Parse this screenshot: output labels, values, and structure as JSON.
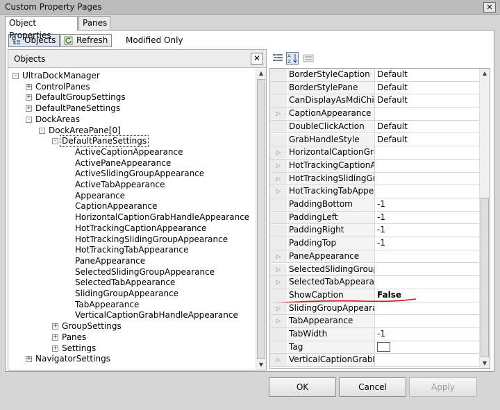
{
  "window": {
    "title": "Custom Property Pages"
  },
  "tabs": [
    {
      "label": "Object Properties"
    },
    {
      "label": "Panes"
    }
  ],
  "toolbar": {
    "objects_label": "Objects",
    "refresh_label": "Refresh",
    "modified_only_label": "Modified Only"
  },
  "objects_panel": {
    "header": "Objects",
    "close_glyph": "✕"
  },
  "tree": [
    {
      "text": "UltraDockManager",
      "level": 0,
      "exp": "-"
    },
    {
      "text": "ControlPanes",
      "level": 1,
      "exp": "+"
    },
    {
      "text": "DefaultGroupSettings",
      "level": 1,
      "exp": "+"
    },
    {
      "text": "DefaultPaneSettings",
      "level": 1,
      "exp": "+"
    },
    {
      "text": "DockAreas",
      "level": 1,
      "exp": "-"
    },
    {
      "text": "DockAreaPane[0]",
      "level": 2,
      "exp": "-"
    },
    {
      "text": "DefaultPaneSettings",
      "level": 3,
      "exp": "-",
      "selected": true
    },
    {
      "text": "ActiveCaptionAppearance",
      "level": 4
    },
    {
      "text": "ActivePaneAppearance",
      "level": 4
    },
    {
      "text": "ActiveSlidingGroupAppearance",
      "level": 4
    },
    {
      "text": "ActiveTabAppearance",
      "level": 4
    },
    {
      "text": "Appearance",
      "level": 4
    },
    {
      "text": "CaptionAppearance",
      "level": 4
    },
    {
      "text": "HorizontalCaptionGrabHandleAppearance",
      "level": 4
    },
    {
      "text": "HotTrackingCaptionAppearance",
      "level": 4
    },
    {
      "text": "HotTrackingSlidingGroupAppearance",
      "level": 4
    },
    {
      "text": "HotTrackingTabAppearance",
      "level": 4
    },
    {
      "text": "PaneAppearance",
      "level": 4
    },
    {
      "text": "SelectedSlidingGroupAppearance",
      "level": 4
    },
    {
      "text": "SelectedTabAppearance",
      "level": 4
    },
    {
      "text": "SlidingGroupAppearance",
      "level": 4
    },
    {
      "text": "TabAppearance",
      "level": 4
    },
    {
      "text": "VerticalCaptionGrabHandleAppearance",
      "level": 4
    },
    {
      "text": "GroupSettings",
      "level": 3,
      "exp": "+"
    },
    {
      "text": "Panes",
      "level": 3,
      "exp": "+"
    },
    {
      "text": "Settings",
      "level": 3,
      "exp": "+"
    },
    {
      "text": "NavigatorSettings",
      "level": 1,
      "exp": "+"
    }
  ],
  "properties": [
    {
      "name": "BorderStyleCaption",
      "value": "Default"
    },
    {
      "name": "BorderStylePane",
      "value": "Default"
    },
    {
      "name": "CanDisplayAsMdiChild",
      "value": "Default"
    },
    {
      "name": "CaptionAppearance",
      "value": "",
      "expandable": true
    },
    {
      "name": "DoubleClickAction",
      "value": "Default"
    },
    {
      "name": "GrabHandleStyle",
      "value": "Default"
    },
    {
      "name": "HorizontalCaptionGrab",
      "value": "",
      "expandable": true
    },
    {
      "name": "HotTrackingCaptionApp",
      "value": "",
      "expandable": true
    },
    {
      "name": "HotTrackingSlidingGrou",
      "value": "",
      "expandable": true
    },
    {
      "name": "HotTrackingTabAppeara",
      "value": "",
      "expandable": true
    },
    {
      "name": "PaddingBottom",
      "value": "-1"
    },
    {
      "name": "PaddingLeft",
      "value": "-1"
    },
    {
      "name": "PaddingRight",
      "value": "-1"
    },
    {
      "name": "PaddingTop",
      "value": "-1"
    },
    {
      "name": "PaneAppearance",
      "value": "",
      "expandable": true
    },
    {
      "name": "SelectedSlidingGroupAp",
      "value": "",
      "expandable": true
    },
    {
      "name": "SelectedTabAppearance",
      "value": "",
      "expandable": true
    },
    {
      "name": "ShowCaption",
      "value": "False",
      "bold": true,
      "annotated": true
    },
    {
      "name": "SlidingGroupAppearanc",
      "value": "",
      "expandable": true
    },
    {
      "name": "TabAppearance",
      "value": "",
      "expandable": true
    },
    {
      "name": "TabWidth",
      "value": "-1"
    },
    {
      "name": "Tag",
      "value": "",
      "colorbox": true
    },
    {
      "name": "VerticalCaptionGrabHar",
      "value": "",
      "expandable": true
    }
  ],
  "buttons": {
    "ok": "OK",
    "cancel": "Cancel",
    "apply": "Apply"
  },
  "colors": {
    "annotation": "#d01818",
    "selection": "#dfe6ef"
  }
}
